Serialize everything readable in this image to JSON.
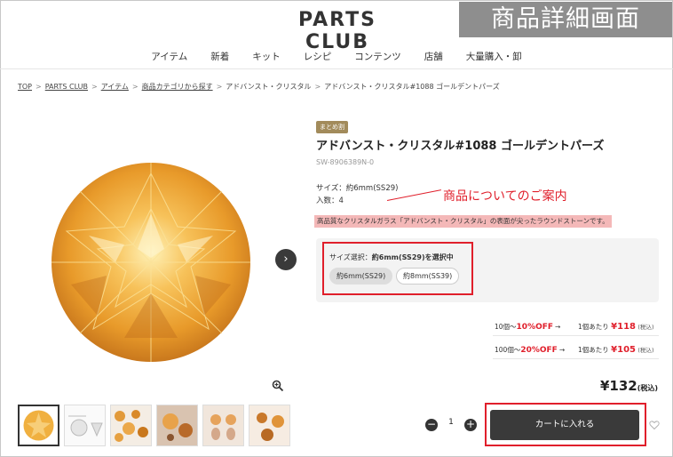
{
  "header": {
    "logo": "PARTS CLUB",
    "annotation_badge": "商品詳細画面"
  },
  "nav": {
    "items": [
      {
        "label": "アイテム"
      },
      {
        "label": "新着"
      },
      {
        "label": "キット"
      },
      {
        "label": "レシピ"
      },
      {
        "label": "コンテンツ"
      },
      {
        "label": "店舗"
      },
      {
        "label": "大量購入・卸"
      }
    ]
  },
  "breadcrumb": {
    "items": [
      {
        "label": "TOP"
      },
      {
        "label": "PARTS CLUB"
      },
      {
        "label": "アイテム"
      },
      {
        "label": "商品カテゴリから探す"
      },
      {
        "label": "アドバンスト・クリスタル"
      },
      {
        "label": "アドバンスト・クリスタル#1088 ゴールデントパーズ"
      }
    ],
    "separator": ">"
  },
  "product": {
    "tag": "まとめ割",
    "title": "アドバンスト・クリスタル#1088 ゴールデントパーズ",
    "sku": "SW-8906389N-0",
    "spec_size": "サイズ：約6mm(SS29)",
    "spec_qty": "入数：4",
    "description": "高品質なクリスタルガラス「アドバンスト・クリスタル」の表面が尖ったラウンドストーンです。",
    "annotation": "商品についてのご案内",
    "size_select": {
      "label_prefix": "サイズ選択：",
      "label_value": "約6mm(SS29)を選択中",
      "options": [
        {
          "label": "約6mm(SS29)",
          "selected": true
        },
        {
          "label": "約8mm(SS39)",
          "selected": false
        }
      ]
    },
    "bulk_discounts": [
      {
        "qty": "10個～",
        "pct": "10%OFF",
        "arrow": "→",
        "unit": "1個あたり",
        "price": "¥118",
        "tax": "(税込)"
      },
      {
        "qty": "100個～",
        "pct": "20%OFF",
        "arrow": "→",
        "unit": "1個あたり",
        "price": "¥105",
        "tax": "(税込)"
      }
    ],
    "price": "¥132",
    "price_tax": "(税込)",
    "quantity": "1",
    "qty_minus": "−",
    "qty_plus": "+",
    "cart_button": "カートに入れる",
    "next_arrow": "›"
  },
  "colors": {
    "accent_red": "#e01f2b",
    "dark_button": "#3a3a3a",
    "tag_gold": "#a28b5b",
    "crystal_gold": "#f2a83a"
  },
  "icons": {
    "zoom": "zoom-in-icon",
    "heart": "heart-icon",
    "next": "chevron-right-icon"
  }
}
